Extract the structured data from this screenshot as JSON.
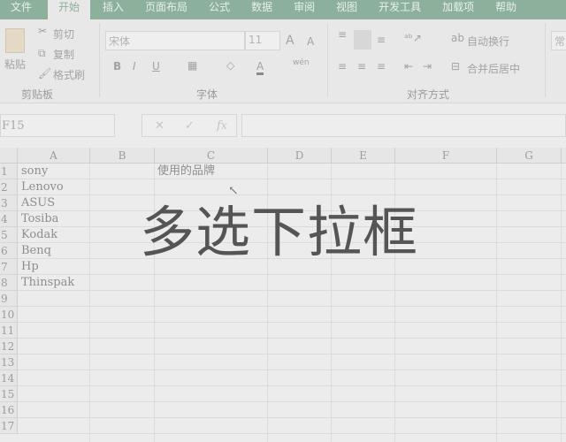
{
  "tabs": [
    "文件",
    "开始",
    "插入",
    "页面布局",
    "公式",
    "数据",
    "审阅",
    "视图",
    "开发工具",
    "加载项",
    "帮助"
  ],
  "clipboard": {
    "paste": "粘贴",
    "cut": "剪切",
    "copy": "复制",
    "format_painter": "格式刷",
    "group": "剪贴板"
  },
  "font": {
    "name": "宋体",
    "size": "11",
    "bold": "B",
    "italic": "I",
    "underline": "U",
    "font_color": "A",
    "phonetic": "wén",
    "group": "字体",
    "grow": "A",
    "shrink": "A"
  },
  "alignment": {
    "wrap": "自动换行",
    "merge": "合并后居中",
    "group": "对齐方式"
  },
  "number": {
    "format": "常"
  },
  "formula_bar": {
    "name_box": "F15",
    "fx": "fx",
    "cancel": "✕",
    "enter": "✓"
  },
  "columns": [
    "A",
    "B",
    "C",
    "D",
    "E",
    "F",
    "G"
  ],
  "rows": [
    "1",
    "2",
    "3",
    "4",
    "5",
    "6",
    "7",
    "8",
    "9",
    "10",
    "11",
    "12",
    "13",
    "14",
    "15",
    "16",
    "17"
  ],
  "cells": {
    "A": [
      "sony",
      "Lenovo",
      "ASUS",
      "Tosiba",
      "Kodak",
      "Benq",
      "Hp",
      "Thinspak"
    ],
    "C1": "使用的品牌"
  },
  "overlay_title": "多选下拉框"
}
